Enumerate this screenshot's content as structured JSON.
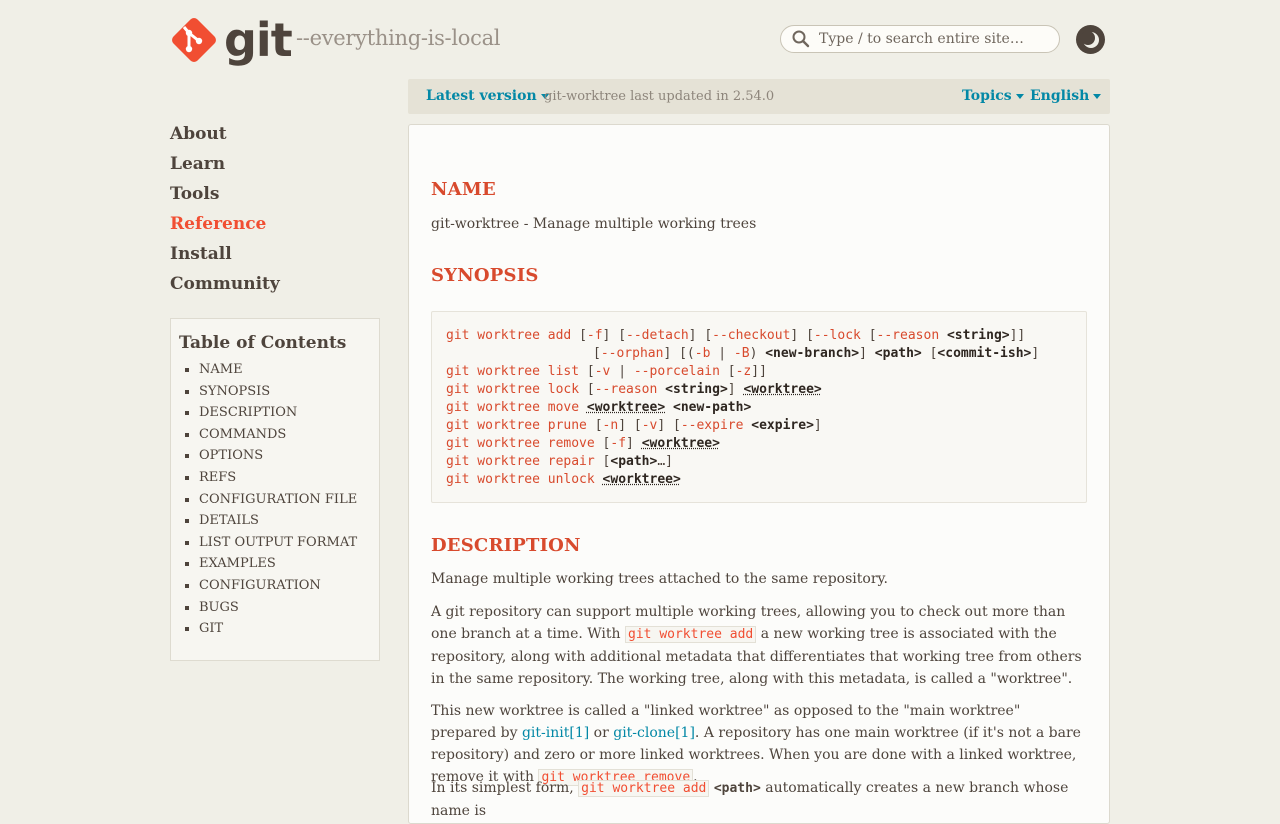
{
  "header": {
    "logo_text": "git",
    "tagline": "--everything-is-local",
    "search_placeholder": "Type / to search entire site…",
    "theme_toggle_icon": "moon-icon"
  },
  "version_bar": {
    "latest_label": "Latest version",
    "updated_text": "git-worktree last updated in 2.54.0",
    "topics_label": "Topics",
    "language_label": "English"
  },
  "nav": {
    "items": [
      "About",
      "Learn",
      "Tools",
      "Reference",
      "Install",
      "Community"
    ],
    "active": "Reference"
  },
  "toc": {
    "title": "Table of Contents",
    "items": [
      "NAME",
      "SYNOPSIS",
      "DESCRIPTION",
      "COMMANDS",
      "OPTIONS",
      "REFS",
      "CONFIGURATION FILE",
      "DETAILS",
      "LIST OUTPUT FORMAT",
      "EXAMPLES",
      "CONFIGURATION",
      "BUGS",
      "GIT"
    ]
  },
  "content": {
    "name_heading": "NAME",
    "name_text": "git-worktree - Manage multiple working trees",
    "synopsis_heading": "SYNOPSIS",
    "synopsis": {
      "cmd": "git worktree",
      "l1_sub": "add",
      "l1_opts": [
        "-f",
        "--detach",
        "--checkout",
        "--lock",
        "--reason"
      ],
      "l1_arg": "<string>",
      "l2_opts": [
        "--orphan",
        "-b",
        "-B"
      ],
      "l2_args": [
        "<new-branch>",
        "<path>",
        "<commit-ish>"
      ],
      "l3_sub": "list",
      "l3_opts": [
        "-v",
        "--porcelain",
        "-z"
      ],
      "l4_sub": "lock",
      "l4_opt": "--reason",
      "l4_args": [
        "<string>",
        "<worktree>"
      ],
      "l5_sub": "move",
      "l5_args": [
        "<worktree>",
        "<new-path>"
      ],
      "l6_sub": "prune",
      "l6_opts": [
        "-n",
        "-v",
        "--expire"
      ],
      "l6_arg": "<expire>",
      "l7_sub": "remove",
      "l7_opt": "-f",
      "l7_arg": "<worktree>",
      "l8_sub": "repair",
      "l8_arg": "<path>",
      "l9_sub": "unlock",
      "l9_arg": "<worktree>"
    },
    "description_heading": "DESCRIPTION",
    "desc_p1": "Manage multiple working trees attached to the same repository.",
    "desc_p2_a": "A git repository can support multiple working trees, allowing you to check out more than one branch at a time. With ",
    "desc_p2_code": "git worktree add",
    "desc_p2_b": " a new working tree is associated with the repository, along with additional metadata that differentiates that working tree from others in the same repository. The working tree, along with this metadata, is called a \"worktree\".",
    "desc_p3_a": "This new worktree is called a \"linked worktree\" as opposed to the \"main worktree\" prepared by ",
    "desc_p3_link1": "git-init[1]",
    "desc_p3_b": " or ",
    "desc_p3_link2": "git-clone[1]",
    "desc_p3_c": ". A repository has one main worktree (if it's not a bare repository) and zero or more linked worktrees. When you are done with a linked worktree, remove it with ",
    "desc_p3_code": "git worktree remove",
    "desc_p3_d": ".",
    "desc_p4_a": "In its simplest form, ",
    "desc_p4_code": "git worktree add",
    "desc_p4_arg": "<path>",
    "desc_p4_b": " automatically creates a new branch whose name is"
  }
}
